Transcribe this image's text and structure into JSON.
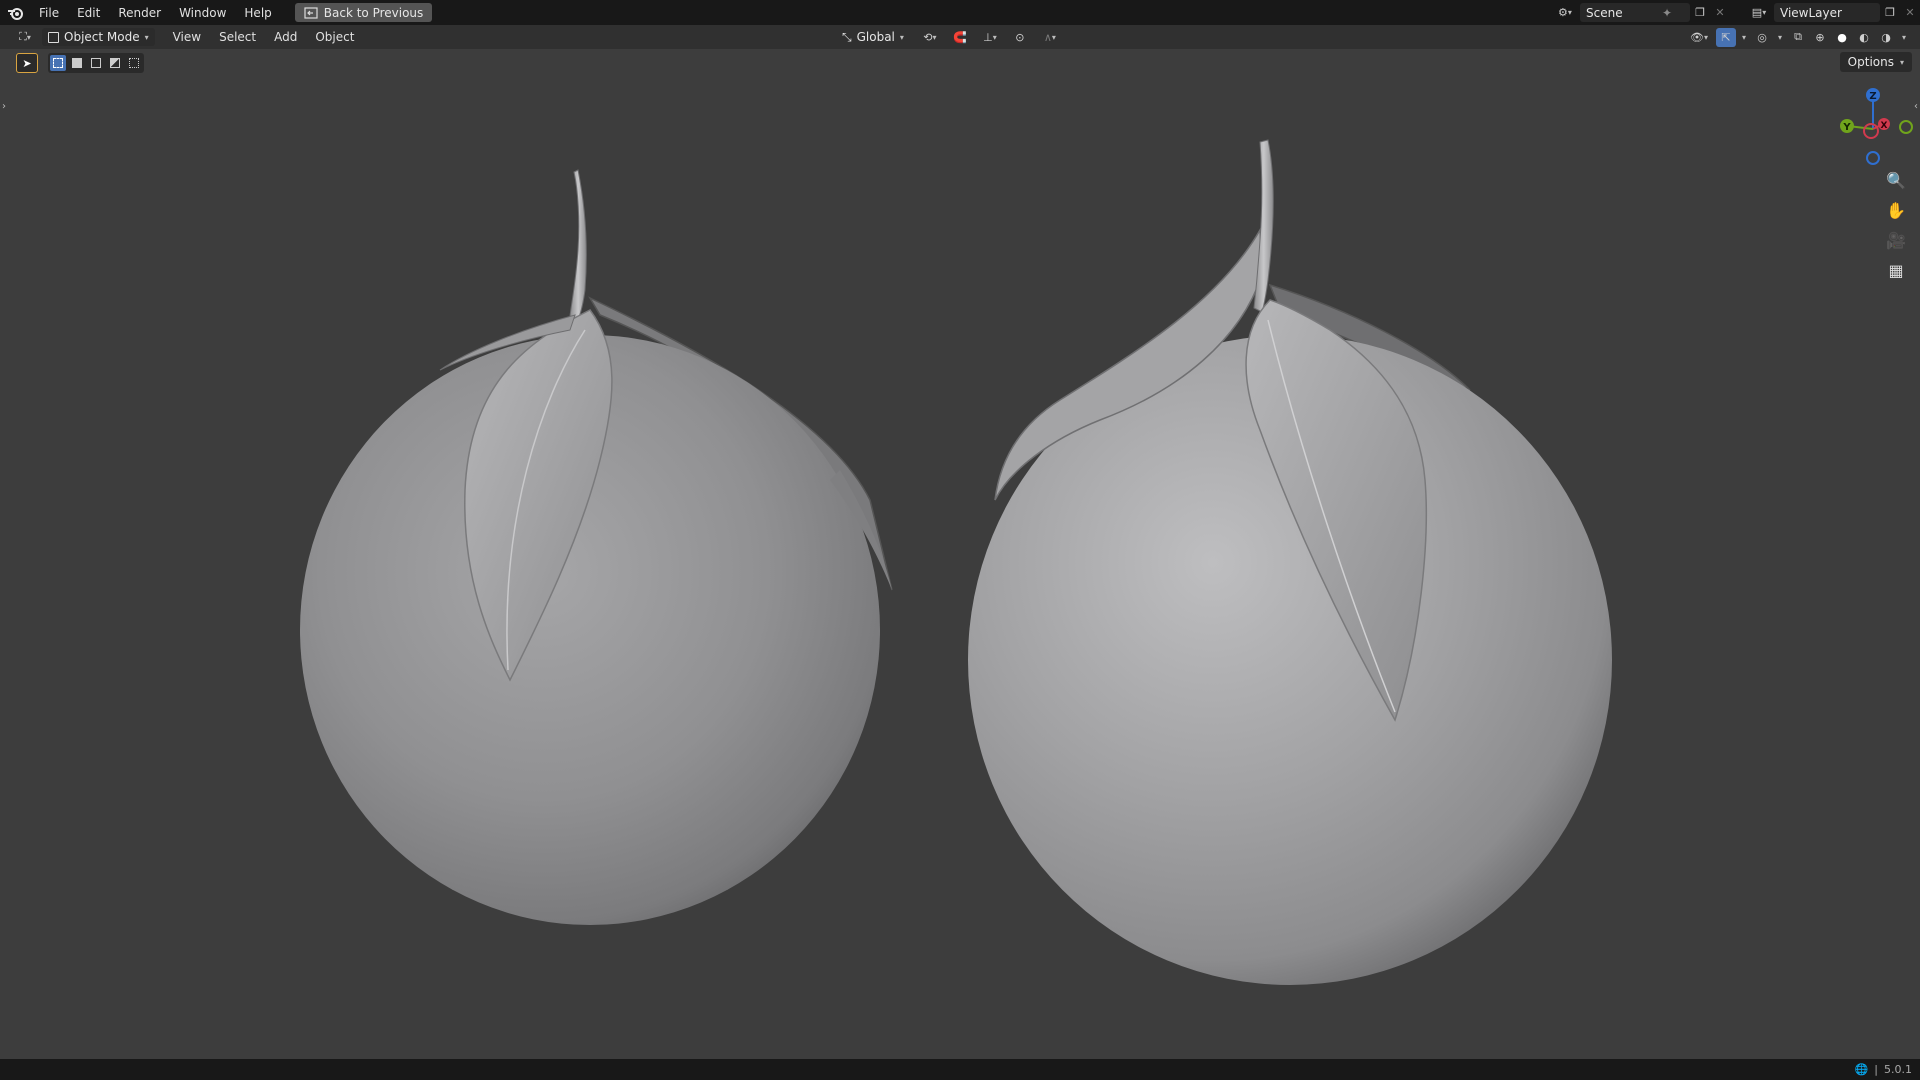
{
  "topbar": {
    "menu": [
      "File",
      "Edit",
      "Render",
      "Window",
      "Help"
    ],
    "back_button": "Back to Previous",
    "scene_name": "Scene",
    "view_layer": "ViewLayer"
  },
  "header": {
    "mode": "Object Mode",
    "menus": [
      "View",
      "Select",
      "Add",
      "Object"
    ],
    "transform_orientation": "Global"
  },
  "options_label": "Options",
  "gizmo": {
    "z": "Z",
    "y": "Y",
    "x": "X"
  },
  "status": {
    "version": "5.0.1"
  },
  "colors": {
    "select_blue": "#4772b3",
    "active_tool_outline": "#d9a441",
    "axis_x": "#d23a4e",
    "axis_y": "#70a41c",
    "axis_z": "#2f6fd0"
  }
}
